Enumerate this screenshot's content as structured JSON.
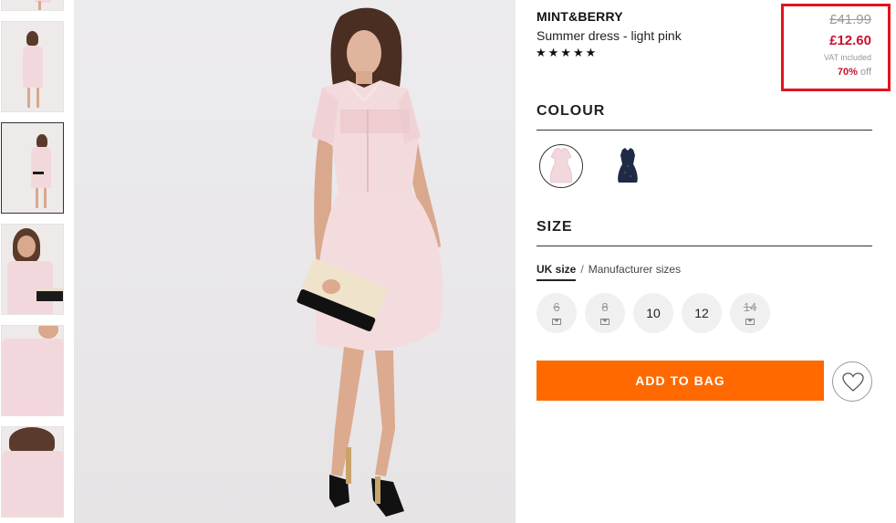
{
  "thumbnails": [
    {
      "alt": "thumb-1"
    },
    {
      "alt": "thumb-2"
    },
    {
      "alt": "thumb-3",
      "selected": true
    },
    {
      "alt": "thumb-4"
    },
    {
      "alt": "thumb-5"
    },
    {
      "alt": "thumb-6"
    }
  ],
  "product": {
    "brand": "MINT&BERRY",
    "name": "Summer dress - light pink",
    "stars": "★★★★★"
  },
  "price": {
    "old": "£41.99",
    "new": "£12.60",
    "vat": "VAT included",
    "discount_pct": "70%",
    "discount_suffix": "off"
  },
  "colour": {
    "title": "COLOUR",
    "options": [
      {
        "name": "light pink",
        "hex": "#f2d8dc",
        "selected": true
      },
      {
        "name": "navy",
        "hex": "#1f2a44",
        "selected": false
      }
    ]
  },
  "size": {
    "title": "SIZE",
    "tab_uk": "UK size",
    "separator": "/",
    "tab_manufacturer": "Manufacturer sizes",
    "options": [
      {
        "label": "6",
        "available": false
      },
      {
        "label": "8",
        "available": false
      },
      {
        "label": "10",
        "available": true
      },
      {
        "label": "12",
        "available": true
      },
      {
        "label": "14",
        "available": false
      }
    ]
  },
  "actions": {
    "add_to_bag": "ADD TO BAG"
  },
  "colors": {
    "accent": "#ff6900",
    "sale": "#c8102e",
    "highlight_box": "#e3141d"
  }
}
